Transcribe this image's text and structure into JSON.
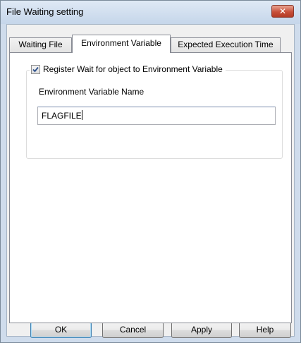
{
  "window": {
    "title": "File Waiting setting",
    "close_icon": "close-icon"
  },
  "tabs": [
    {
      "label": "Waiting File",
      "active": false
    },
    {
      "label": "Environment Variable",
      "active": true
    },
    {
      "label": "Expected Execution Time",
      "active": false
    }
  ],
  "panel": {
    "checkbox_label": "Register Wait for object to Environment Variable",
    "checkbox_checked": true,
    "field_label": "Environment Variable Name",
    "field_value": "FLAGFILE"
  },
  "buttons": {
    "ok": "OK",
    "cancel": "Cancel",
    "apply": "Apply",
    "help": "Help"
  }
}
